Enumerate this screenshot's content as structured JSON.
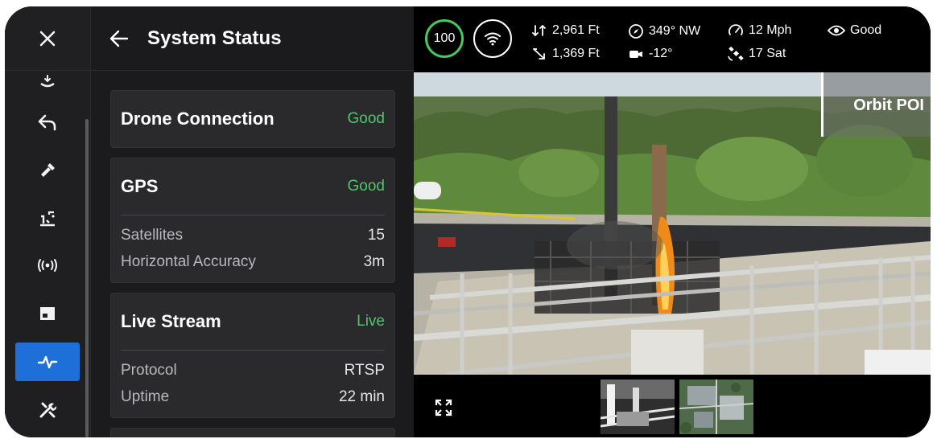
{
  "rail": {
    "items": [
      {
        "name": "landing-icon"
      },
      {
        "name": "return-home-icon"
      },
      {
        "name": "flashlight-icon"
      },
      {
        "name": "mission-icon"
      },
      {
        "name": "broadcast-icon"
      },
      {
        "name": "display-icon"
      },
      {
        "name": "activity-icon",
        "active": true
      },
      {
        "name": "tools-icon"
      }
    ]
  },
  "panel": {
    "title": "System Status",
    "cards": [
      {
        "title": "Drone Connection",
        "status": "Good"
      },
      {
        "title": "GPS",
        "status": "Good",
        "rows": [
          {
            "label": "Satellites",
            "value": "15"
          },
          {
            "label": "Horizontal Accuracy",
            "value": "3m"
          }
        ]
      },
      {
        "title": "Live Stream",
        "status": "Live",
        "rows": [
          {
            "label": "Protocol",
            "value": "RTSP"
          },
          {
            "label": "Uptime",
            "value": "22 min"
          }
        ]
      }
    ]
  },
  "telemetry": {
    "battery": "100",
    "altitude": "2,961 Ft",
    "distance": "1,369 Ft",
    "heading": "349° NW",
    "gimbal": "-12°",
    "speed": "12 Mph",
    "satellites": "17 Sat",
    "visibility": "Good"
  },
  "video": {
    "overlay_label": "Orbit POI"
  },
  "colors": {
    "accent": "#1f6fd9",
    "good": "#4fc76a",
    "battery_ring": "#45c95f"
  }
}
